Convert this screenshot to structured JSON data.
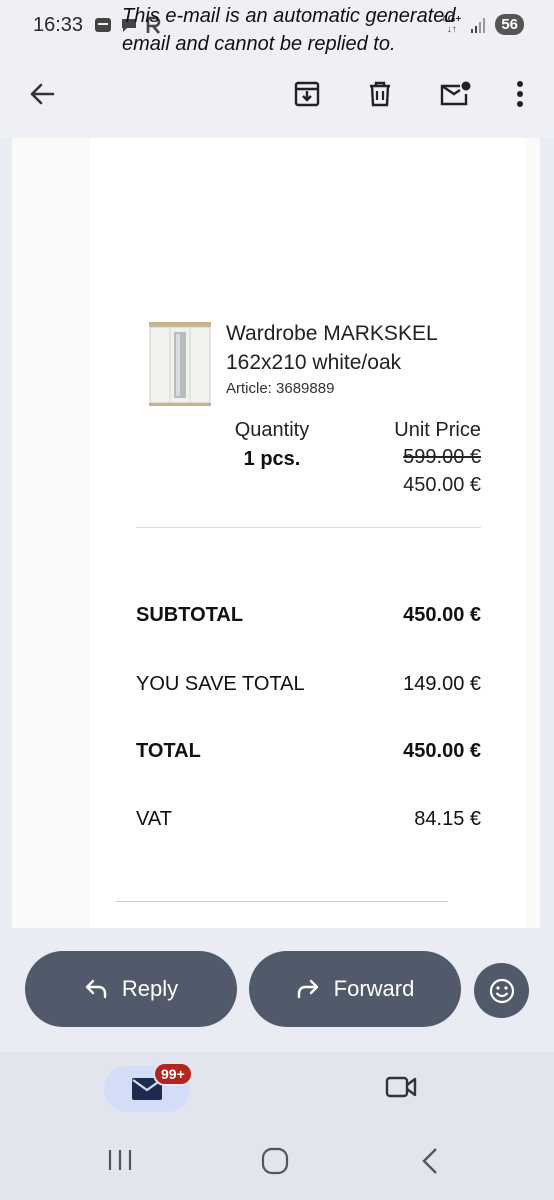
{
  "status_bar": {
    "time": "16:33",
    "network_top": "4G+",
    "network_bottom": "↓↑",
    "battery": "56"
  },
  "toolbar": {
    "icons": [
      "back-arrow-icon",
      "archive-icon",
      "delete-icon",
      "mark-unread-icon",
      "more-icon"
    ]
  },
  "email": {
    "auto_note": "This e-mail is an automatic generated email and cannot be replied to.",
    "product": {
      "name": "Wardrobe MARKSKEL 162x210 white/oak",
      "article": "Article: 3689889"
    },
    "quantity_label": "Quantity",
    "quantity_value": "1 pcs.",
    "unit_price_label": "Unit Price",
    "old_price": "599.00 €",
    "new_price": "450.00 €",
    "summary": {
      "subtotal_label": "SUBTOTAL",
      "subtotal_value": "450.00 €",
      "save_label": "YOU SAVE TOTAL",
      "save_value": "149.00 €",
      "total_label": "TOTAL",
      "total_value": "450.00 €",
      "vat_label": "VAT",
      "vat_value": "84.15 €"
    }
  },
  "actions": {
    "reply": "Reply",
    "forward": "Forward"
  },
  "bottom_nav": {
    "mail_badge": "99+"
  },
  "colors": {
    "pill_bg": "#515a6b",
    "badge_bg": "#b3261e",
    "nav_active_bg": "#d3ddf7"
  }
}
